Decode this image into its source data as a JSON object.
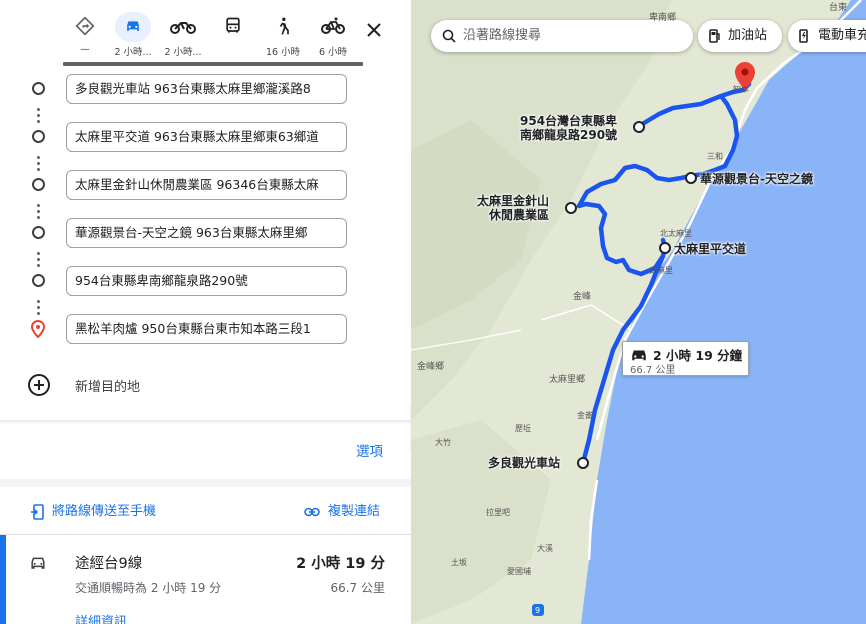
{
  "travel_modes": [
    {
      "name": "best",
      "icon": "directions-icon",
      "time": "—"
    },
    {
      "name": "driving",
      "icon": "car-icon",
      "time": "2 小時..."
    },
    {
      "name": "motorcycle",
      "icon": "motorcycle-icon",
      "time": "2 小時..."
    },
    {
      "name": "transit",
      "icon": "bus-icon",
      "time": ""
    },
    {
      "name": "walking",
      "icon": "walk-icon",
      "time": "16 小時"
    },
    {
      "name": "bicycle",
      "icon": "bicycle-icon",
      "time": "6 小時"
    }
  ],
  "stops": [
    "多良觀光車站 963台東縣太麻里鄉瀧溪路8",
    "太麻里平交道 963台東縣太麻里鄉東63鄉道",
    "太麻里金針山休閒農業區 96346台東縣太麻",
    "華源觀景台-天空之鏡 963台東縣太麻里鄉",
    "954台東縣卑南鄉龍泉路290號",
    "黑松羊肉爐 950台東縣台東市知本路三段1"
  ],
  "add_destination": "新增目的地",
  "options_label": "選項",
  "send_to_phone": "將路線傳送至手機",
  "copy_link": "複製連結",
  "route": {
    "name": "途經台9線",
    "time": "2 小時 19 分",
    "sub": "交通順暢時為 2 小時 19 分",
    "distance": "66.7 公里",
    "details": "詳細資訊"
  },
  "map": {
    "search_placeholder": "沿著路線搜尋",
    "chip_gas": "加油站",
    "chip_ev": "電動車充",
    "duration_main": "2 小時 19 分鐘",
    "duration_sub": "66.7 公里",
    "poi_labels": {
      "longquan": "954台灣台東縣卑\n南鄉龍泉路290號",
      "huayuan": "華源觀景台-天空之鏡",
      "jinzhen": "太麻里金針山\n休閒農業區",
      "crossing": "太麻里平交道",
      "duoliang": "多良觀光車站"
    },
    "place_labels": {
      "beinan": "卑南鄉",
      "taitung": "台東",
      "zhiben": "知本",
      "sanhe": "三和",
      "beitaimali": "北太麻里",
      "taimali": "太麻里",
      "jinfeng": "金峰",
      "jinfeng_xiang": "金峰鄉",
      "taimali_xiang": "太麻里鄉",
      "jinlun": "金崙",
      "lixi": "歷坵",
      "dazhu": "大竹",
      "tuban": "土坂",
      "dawu": "大溪",
      "aiguo": "愛國埔",
      "lalibai": "拉里吧",
      "road9": "9"
    }
  },
  "colors": {
    "route": "#1a55f0",
    "accent": "#1a73e8",
    "sea": "#8ab4f8",
    "destination": "#ea4335"
  }
}
